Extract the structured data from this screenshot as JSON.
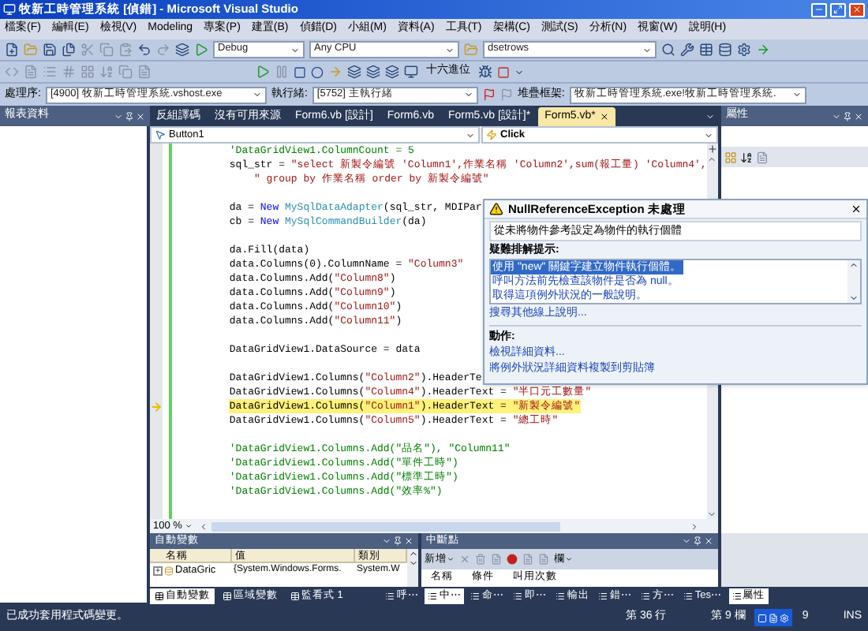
{
  "window": {
    "title": "牧新工時管理系統 [偵錯] - Microsoft Visual Studio"
  },
  "menu": [
    "檔案(F)",
    "編輯(E)",
    "檢視(V)",
    "Modeling",
    "專案(P)",
    "建置(B)",
    "偵錯(D)",
    "小組(M)",
    "資料(A)",
    "工具(T)",
    "架構(C)",
    "測試(S)",
    "分析(N)",
    "視窗(W)",
    "說明(H)"
  ],
  "toolbar": {
    "configuration": "Debug",
    "platform": "Any CPU",
    "find": "dsetrows",
    "hex_label": "十六進位"
  },
  "debug_location": {
    "process_label": "處理序:",
    "process": "[4900] 牧新工時管理系統.vshost.exe",
    "thread_label": "執行緒:",
    "thread": "[5752] 主執行緒",
    "stack_label": "堆疊框架:",
    "stack_frame": "牧新工時管理系統.exe!牧新工時管理系統."
  },
  "left_panel": {
    "title": "報表資料"
  },
  "editor": {
    "tabs": [
      {
        "label": "反組譯碼",
        "selected": false
      },
      {
        "label": "沒有可用來源",
        "selected": false
      },
      {
        "label": "Form6.vb [設計]",
        "selected": false
      },
      {
        "label": "Form6.vb",
        "selected": false
      },
      {
        "label": "Form5.vb [設計]*",
        "selected": false
      },
      {
        "label": "Form5.vb*",
        "selected": true
      }
    ],
    "object_combo": "Button1",
    "event_combo": "Click",
    "zoom": "100 %",
    "lines": [
      {
        "kind": "code",
        "current": false,
        "segments": [
          {
            "kind": "comment",
            "text": "'DataGridView1.ColumnCount = 5"
          }
        ]
      },
      {
        "kind": "code",
        "current": false,
        "segments": [
          {
            "kind": "plain",
            "text": "sql_str = "
          },
          {
            "kind": "string",
            "text": "\"select 新製令編號 'Column1',作業名稱 'Column2',sum(報工量) 'Column4',"
          }
        ]
      },
      {
        "kind": "code",
        "current": false,
        "segments": [
          {
            "kind": "string",
            "text": "    \" group by 作業名稱 order by 新製令編號\""
          }
        ]
      },
      {
        "kind": "blank",
        "current": false
      },
      {
        "kind": "code",
        "current": false,
        "segments": [
          {
            "kind": "plain",
            "text": "da = "
          },
          {
            "kind": "keyword",
            "text": "New"
          },
          {
            "kind": "type",
            "text": " MySqlDataAdapter"
          },
          {
            "kind": "plain",
            "text": "(sql_str, MDIPar"
          }
        ]
      },
      {
        "kind": "code",
        "current": false,
        "segments": [
          {
            "kind": "plain",
            "text": "cb = "
          },
          {
            "kind": "keyword",
            "text": "New"
          },
          {
            "kind": "type",
            "text": " MySqlCommandBuilder"
          },
          {
            "kind": "plain",
            "text": "(da)"
          }
        ]
      },
      {
        "kind": "blank",
        "current": false
      },
      {
        "kind": "code",
        "current": false,
        "segments": [
          {
            "kind": "plain",
            "text": "da.Fill(data)"
          }
        ]
      },
      {
        "kind": "code",
        "current": false,
        "segments": [
          {
            "kind": "plain",
            "text": "data.Columns(0).ColumnName = "
          },
          {
            "kind": "string",
            "text": "\"Column3\""
          }
        ]
      },
      {
        "kind": "code",
        "current": false,
        "segments": [
          {
            "kind": "plain",
            "text": "data.Columns.Add("
          },
          {
            "kind": "string",
            "text": "\"Column8\""
          },
          {
            "kind": "plain",
            "text": ")"
          }
        ]
      },
      {
        "kind": "code",
        "current": false,
        "segments": [
          {
            "kind": "plain",
            "text": "data.Columns.Add("
          },
          {
            "kind": "string",
            "text": "\"Column9\""
          },
          {
            "kind": "plain",
            "text": ")"
          }
        ]
      },
      {
        "kind": "code",
        "current": false,
        "segments": [
          {
            "kind": "plain",
            "text": "data.Columns.Add("
          },
          {
            "kind": "string",
            "text": "\"Column10\""
          },
          {
            "kind": "plain",
            "text": ")"
          }
        ]
      },
      {
        "kind": "code",
        "current": false,
        "segments": [
          {
            "kind": "plain",
            "text": "data.Columns.Add("
          },
          {
            "kind": "string",
            "text": "\"Column11\""
          },
          {
            "kind": "plain",
            "text": ")"
          }
        ]
      },
      {
        "kind": "blank",
        "current": false
      },
      {
        "kind": "code",
        "current": false,
        "segments": [
          {
            "kind": "plain",
            "text": "DataGridView1.DataSource = data"
          }
        ]
      },
      {
        "kind": "blank",
        "current": false
      },
      {
        "kind": "code",
        "current": false,
        "segments": [
          {
            "kind": "plain",
            "text": "DataGridView1.Columns("
          },
          {
            "kind": "string",
            "text": "\"Column2\""
          },
          {
            "kind": "plain",
            "text": ").HeaderTe"
          }
        ]
      },
      {
        "kind": "code",
        "current": false,
        "segments": [
          {
            "kind": "plain",
            "text": "DataGridView1.Columns("
          },
          {
            "kind": "string",
            "text": "\"Column4\""
          },
          {
            "kind": "plain",
            "text": ").HeaderText = "
          },
          {
            "kind": "string",
            "text": "\"半口元工數量\""
          }
        ]
      },
      {
        "kind": "code",
        "current": true,
        "segments": [
          {
            "kind": "plain",
            "text": "DataGridView1.Columns("
          },
          {
            "kind": "string",
            "text": "\"Column1\""
          },
          {
            "kind": "plain",
            "text": ").HeaderText = "
          },
          {
            "kind": "string",
            "text": "\"新製令編號\""
          }
        ]
      },
      {
        "kind": "code",
        "current": false,
        "segments": [
          {
            "kind": "plain",
            "text": "DataGridView1.Columns("
          },
          {
            "kind": "string",
            "text": "\"Column5\""
          },
          {
            "kind": "plain",
            "text": ").HeaderText = "
          },
          {
            "kind": "string",
            "text": "\"總工時\""
          }
        ]
      },
      {
        "kind": "blank",
        "current": false
      },
      {
        "kind": "code",
        "current": false,
        "segments": [
          {
            "kind": "comment",
            "text": "'DataGridView1.Columns.Add(\"品名\"), \"Column11\""
          }
        ]
      },
      {
        "kind": "code",
        "current": false,
        "segments": [
          {
            "kind": "comment",
            "text": "'DataGridView1.Columns.Add(\"單件工時\")"
          }
        ]
      },
      {
        "kind": "code",
        "current": false,
        "segments": [
          {
            "kind": "comment",
            "text": "'DataGridView1.Columns.Add(\"標準工時\")"
          }
        ]
      },
      {
        "kind": "code",
        "current": false,
        "segments": [
          {
            "kind": "comment",
            "text": "'DataGridView1.Columns.Add(\"效率%\")"
          }
        ]
      }
    ]
  },
  "exception": {
    "title": "NullReferenceException 未處理",
    "message": "從未將物件參考設定為物件的執行個體",
    "tips_heading": "疑難排解提示:",
    "tips": [
      {
        "text": "使用 \"new\" 關鍵字建立物件執行個體。",
        "selected": true
      },
      {
        "text": "呼叫方法前先檢查該物件是否為 null。",
        "selected": false
      },
      {
        "text": "取得這項例外狀況的一般說明。",
        "selected": false
      }
    ],
    "search_link": "搜尋其他線上說明...",
    "actions_heading": "動作:",
    "actions": [
      "檢視詳細資料...",
      "將例外狀況詳細資料複製到剪貼簿"
    ]
  },
  "properties": {
    "title": "屬性"
  },
  "autos": {
    "title": "自動變數",
    "columns": [
      "名稱",
      "值",
      "類別"
    ],
    "rows": [
      {
        "cells": [
          "DataGric",
          "{System.Windows.Forms.",
          "System.W"
        ],
        "expanded": false
      }
    ],
    "tabs": [
      {
        "label": "自動變數",
        "selected": true
      },
      {
        "label": "區域變數",
        "selected": false
      },
      {
        "label": "監看式 1",
        "selected": false
      }
    ]
  },
  "breakpoints": {
    "title": "中斷點",
    "new_button": "新增",
    "columns_button": "欄",
    "columns": [
      "名稱",
      "條件",
      "叫用次數"
    ]
  },
  "bottom_tabs": [
    {
      "label": "呼⋯",
      "selected": false
    },
    {
      "label": "中⋯",
      "selected": true
    },
    {
      "label": "命⋯",
      "selected": false
    },
    {
      "label": "即⋯",
      "selected": false
    },
    {
      "label": "輸出",
      "selected": false
    },
    {
      "label": "錯⋯",
      "selected": false
    },
    {
      "label": "方⋯",
      "selected": false
    },
    {
      "label": "Tes⋯",
      "selected": false
    },
    {
      "label": "屬性",
      "selected": true
    }
  ],
  "status_bar": {
    "message": "已成功套用程式碼變更。",
    "line": "第 36 行",
    "column": "第 9 欄",
    "char": "9",
    "mode": "INS"
  }
}
